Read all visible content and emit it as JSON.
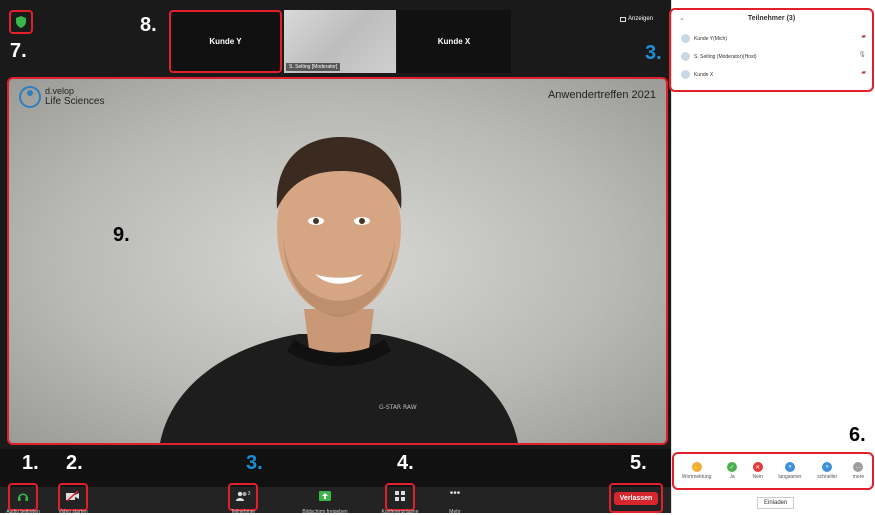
{
  "markers": {
    "m1": "1.",
    "m2": "2.",
    "m3_toolbar": "3.",
    "m3_panel": "3.",
    "m4": "4.",
    "m5": "5.",
    "m6": "6.",
    "m7": "7.",
    "m8": "8.",
    "m9": "9."
  },
  "topbar": {
    "thumbs": [
      {
        "label": "Kunde Y"
      },
      {
        "label": "",
        "caption": "S. Selting [Moderator]"
      },
      {
        "label": "Kunde X"
      }
    ],
    "view_label": "Anzeigen"
  },
  "main_video": {
    "logo_line1": "d.velop",
    "logo_line2": "Life Sciences",
    "event_title": "Anwendertreffen 2021"
  },
  "toolbar": {
    "audio_label": "Audio beitreten",
    "video_label": "Video starten",
    "participants_label": "Teilnehmer",
    "participants_count": "3",
    "share_label": "Bildschirm freigeben",
    "breakout_label": "Konferenzräume",
    "more_label": "Mehr",
    "leave_label": "Verlassen"
  },
  "participants_panel": {
    "title": "Teilnehmer (3)",
    "rows": [
      {
        "name": "Kunde Y(Mich)"
      },
      {
        "name": "S. Selting (Moderator)(Host)"
      },
      {
        "name": "Kunde X"
      }
    ],
    "invite_label": "Einladen"
  },
  "reactions": [
    {
      "label": "Wortmeldung",
      "color": "#f2a93b",
      "glyph": "✋"
    },
    {
      "label": "Ja",
      "color": "#4caf50",
      "glyph": "✓"
    },
    {
      "label": "Nein",
      "color": "#e53935",
      "glyph": "✕"
    },
    {
      "label": "langsamer",
      "color": "#3f8fd8",
      "glyph": "«"
    },
    {
      "label": "schneller",
      "color": "#3f8fd8",
      "glyph": "»"
    },
    {
      "label": "more",
      "color": "#9e9e9e",
      "glyph": "…"
    }
  ],
  "colors": {
    "highlight_red": "#e0202a",
    "marker_blue": "#1a8fd6",
    "leave_red": "#d8262c"
  }
}
